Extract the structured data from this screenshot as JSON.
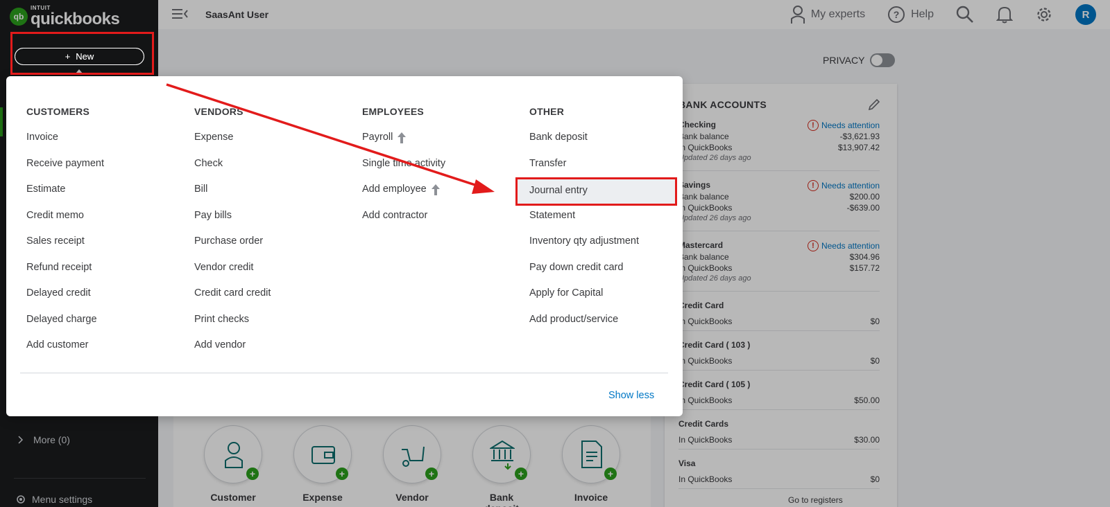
{
  "logo": {
    "intuit": "INTUIT",
    "brand": "quickbooks",
    "mark": "qb"
  },
  "sidebar": {
    "new_label": "New",
    "more_label": "More (0)",
    "menu_settings_label": "Menu settings"
  },
  "topbar": {
    "company": "SaasAnt User",
    "experts_label": "My experts",
    "help_label": "Help",
    "avatar_initial": "R"
  },
  "privacy_label": "PRIVACY",
  "bank_accounts": {
    "title": "BANK ACCOUNTS",
    "accounts": [
      {
        "name": "Checking",
        "attention": "Needs attention",
        "bank_label": "Bank balance",
        "bank": "-$3,621.93",
        "qb_label": "In QuickBooks",
        "qb": "$13,907.42",
        "updated": "Updated 26 days ago"
      },
      {
        "name": "Savings",
        "attention": "Needs attention",
        "bank_label": "Bank balance",
        "bank": "$200.00",
        "qb_label": "In QuickBooks",
        "qb": "-$639.00",
        "updated": "Updated 26 days ago"
      },
      {
        "name": "Mastercard",
        "attention": "Needs attention",
        "bank_label": "Bank balance",
        "bank": "$304.96",
        "qb_label": "In QuickBooks",
        "qb": "$157.72",
        "updated": "Updated 26 days ago"
      },
      {
        "name": "Credit Card",
        "qb_label": "In QuickBooks",
        "qb": "$0"
      },
      {
        "name": "Credit Card ( 103 )",
        "qb_label": "In QuickBooks",
        "qb": "$0"
      },
      {
        "name": "Credit Card ( 105 )",
        "qb_label": "In QuickBooks",
        "qb": "$50.00"
      },
      {
        "name": "Credit Cards",
        "qb_label": "In QuickBooks",
        "qb": "$30.00"
      },
      {
        "name": "Visa",
        "qb_label": "In QuickBooks",
        "qb": "$0"
      }
    ],
    "footer": "Go to registers"
  },
  "shortcuts": [
    {
      "label": "Customer",
      "icon": "customer-icon"
    },
    {
      "label": "Expense",
      "icon": "wallet-icon"
    },
    {
      "label": "Vendor",
      "icon": "cart-icon"
    },
    {
      "label": "Bank deposit",
      "icon": "bank-icon"
    },
    {
      "label": "Invoice",
      "icon": "invoice-icon"
    }
  ],
  "new_menu": {
    "customers": {
      "heading": "CUSTOMERS",
      "items": [
        "Invoice",
        "Receive payment",
        "Estimate",
        "Credit memo",
        "Sales receipt",
        "Refund receipt",
        "Delayed credit",
        "Delayed charge",
        "Add customer"
      ]
    },
    "vendors": {
      "heading": "VENDORS",
      "items": [
        "Expense",
        "Check",
        "Bill",
        "Pay bills",
        "Purchase order",
        "Vendor credit",
        "Credit card credit",
        "Print checks",
        "Add vendor"
      ]
    },
    "employees": {
      "heading": "EMPLOYEES",
      "items": [
        "Payroll",
        "Single time activity",
        "Add employee",
        "Add contractor"
      ]
    },
    "other": {
      "heading": "OTHER",
      "items": [
        "Bank deposit",
        "Transfer",
        "Journal entry",
        "Statement",
        "Inventory qty adjustment",
        "Pay down credit card",
        "Apply for Capital",
        "Add product/service"
      ]
    },
    "show_less": "Show less"
  },
  "colors": {
    "brand_green": "#2ca01c",
    "link_blue": "#0077c5",
    "annotation_red": "#e21b1b"
  }
}
